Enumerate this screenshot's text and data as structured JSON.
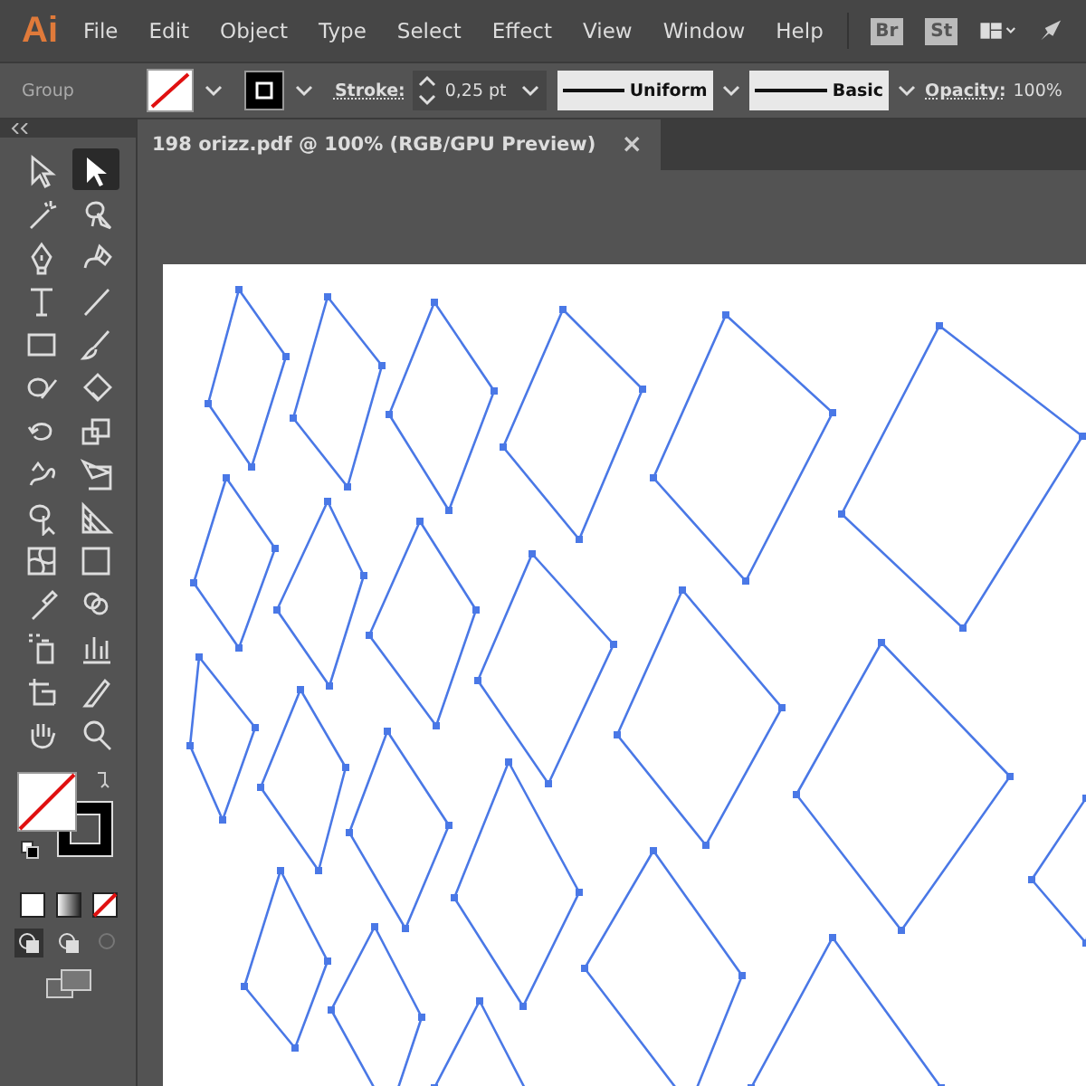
{
  "app_logo": "Ai",
  "menu": [
    "File",
    "Edit",
    "Object",
    "Type",
    "Select",
    "Effect",
    "View",
    "Window",
    "Help"
  ],
  "menu_badges": [
    "Br",
    "St"
  ],
  "control_bar": {
    "selection": "Group",
    "stroke_label": "Stroke:",
    "stroke_weight": "0,25 pt",
    "profile": "Uniform",
    "brush": "Basic",
    "opacity_label": "Opacity:",
    "opacity": "100%"
  },
  "document_tab": {
    "title": "198 orizz.pdf @ 100% (RGB/GPU Preview)",
    "close": "×"
  },
  "tools": [
    {
      "kind": "select",
      "selected": false
    },
    {
      "kind": "direct",
      "selected": true
    },
    {
      "kind": "wand",
      "selected": false
    },
    {
      "kind": "lasso",
      "selected": false
    },
    {
      "kind": "pen",
      "selected": false
    },
    {
      "kind": "curvature",
      "selected": false
    },
    {
      "kind": "type",
      "selected": false
    },
    {
      "kind": "line",
      "selected": false
    },
    {
      "kind": "rect",
      "selected": false
    },
    {
      "kind": "brush",
      "selected": false
    },
    {
      "kind": "shaper",
      "selected": false
    },
    {
      "kind": "eraser",
      "selected": false
    },
    {
      "kind": "rotate",
      "selected": false
    },
    {
      "kind": "scale",
      "selected": false
    },
    {
      "kind": "warp",
      "selected": false
    },
    {
      "kind": "freetransform",
      "selected": false
    },
    {
      "kind": "shapebuilder",
      "selected": false
    },
    {
      "kind": "perspective",
      "selected": false
    },
    {
      "kind": "mesh",
      "selected": false
    },
    {
      "kind": "gradient",
      "selected": false
    },
    {
      "kind": "eyedropper",
      "selected": false
    },
    {
      "kind": "blend",
      "selected": false
    },
    {
      "kind": "symbol",
      "selected": false
    },
    {
      "kind": "graph",
      "selected": false
    },
    {
      "kind": "artboard",
      "selected": false
    },
    {
      "kind": "slice",
      "selected": false
    },
    {
      "kind": "hand",
      "selected": false
    },
    {
      "kind": "zoom",
      "selected": false
    }
  ],
  "draw_modes": [
    {
      "selected": true
    },
    {
      "selected": false
    },
    {
      "selected": false
    }
  ]
}
